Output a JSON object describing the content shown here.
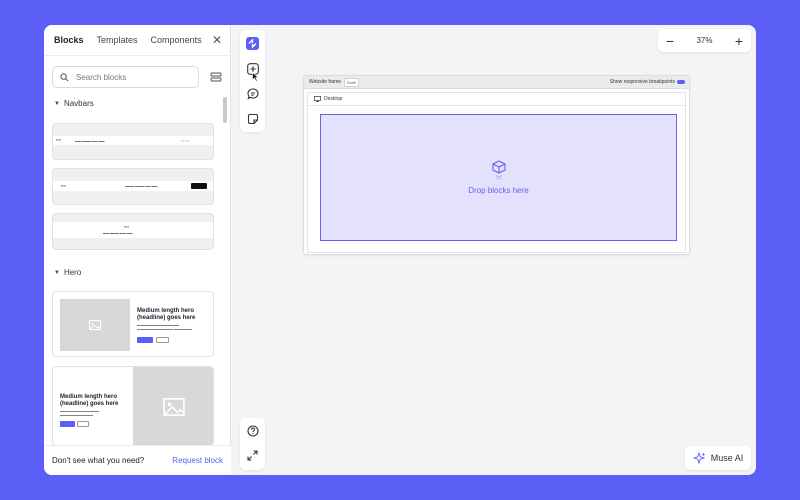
{
  "sidebar": {
    "tabs": [
      {
        "label": "Blocks",
        "active": true
      },
      {
        "label": "Templates",
        "active": false
      },
      {
        "label": "Components",
        "active": false
      }
    ],
    "search": {
      "placeholder": "Search blocks"
    },
    "sections": {
      "navbars": "Navbars",
      "hero": "Hero"
    },
    "hero_title": "Medium length hero (headline) goes here",
    "footer": {
      "question": "Don't see what you need?",
      "link": "Request block"
    }
  },
  "toolbar": {
    "icons": [
      "blocks-icon",
      "add-icon",
      "comment-icon",
      "sticky-note-icon"
    ],
    "bottom": [
      "help-icon",
      "fullscreen-icon"
    ]
  },
  "zoom": {
    "value": "37%"
  },
  "frame": {
    "title": "Website frame",
    "badge": "Draft",
    "responsive_label": "Show responsive breakpoints",
    "responsive_on": true,
    "desktop_label": "Desktop",
    "drop_text": "Drop blocks here"
  },
  "muse": {
    "label": "Muse AI"
  },
  "colors": {
    "accent": "#5b5ff5",
    "dropzone_fill": "#e4e1fd",
    "dropzone_border": "#6b62ea"
  }
}
